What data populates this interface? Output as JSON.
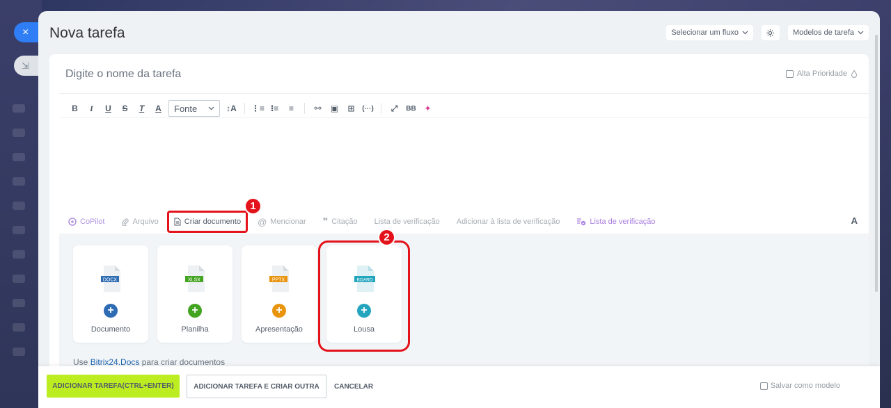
{
  "window": {
    "close_icon": "×",
    "minimize_icon": "⇲"
  },
  "header": {
    "title": "Nova tarefa",
    "flow_select": "Selecionar um fluxo",
    "templates": "Modelos de tarefa"
  },
  "editor": {
    "task_name_placeholder": "Digite o nome da tarefa",
    "priority_label": "Alta Prioridade",
    "toolbar": {
      "bold": "B",
      "italic": "I",
      "underline": "U",
      "strike": "S",
      "clear_format": "T",
      "text_color": "A",
      "font_label": "Fonte",
      "font_size": "↕A",
      "ordered_list": "⋮≡",
      "bullet_list": "⁝≡",
      "align": "≡",
      "link": "⚯",
      "image": "▣",
      "table": "⊞",
      "code": "(···)",
      "fullscreen": "⤢",
      "bbcode": "BB",
      "sticker": "✦"
    }
  },
  "actions": {
    "copilot": "CoPilot",
    "file": "Arquivo",
    "create_document": "Criar documento",
    "mention": "Mencionar",
    "quote": "Citação",
    "checklist_text": "Lista de verificação",
    "add_to_checklist": "Adicionar à lista de verificação",
    "checklist": "Lista de verificação",
    "format": "A"
  },
  "badges": {
    "one": "1",
    "two": "2"
  },
  "documents": {
    "tiles": [
      {
        "label": "Documento",
        "type": "DOCX",
        "color": "#2d6bb2"
      },
      {
        "label": "Planilha",
        "type": "XLSX",
        "color": "#43a422"
      },
      {
        "label": "Apresentação",
        "type": "PPTX",
        "color": "#e8940e"
      },
      {
        "label": "Lousa",
        "type": "BOARD",
        "color": "#23a5be"
      }
    ],
    "plus": "+",
    "hint_prefix": "Use ",
    "hint_link": "Bitrix24.Docs",
    "hint_suffix": " para criar documentos"
  },
  "footer": {
    "add_task": "ADICIONAR TAREFA(CTRL+ENTER)",
    "add_and_create": "ADICIONAR TAREFA E CRIAR OUTRA",
    "cancel": "CANCELAR",
    "save_as_template": "Salvar como modelo"
  },
  "colors": {
    "accent": "#bbed21",
    "highlight": "#e4131b",
    "close_blue": "#2f7ef5"
  }
}
